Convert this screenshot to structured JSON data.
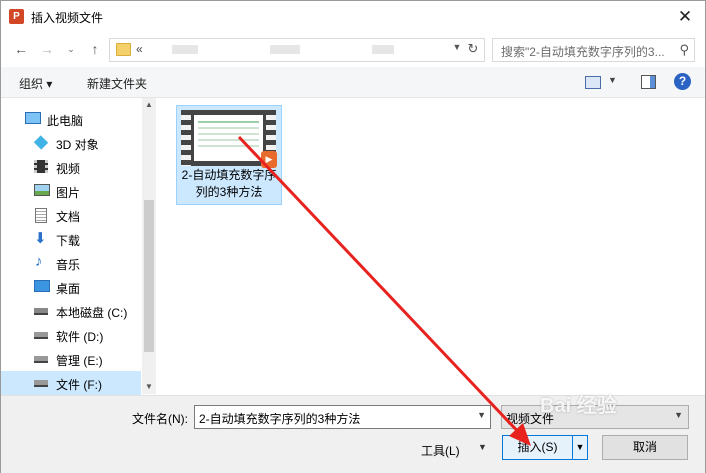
{
  "window": {
    "title": "插入视频文件",
    "app_icon_letter": "P"
  },
  "address": {
    "crumb": "«",
    "search_placeholder": "搜索\"2-自动填充数字序列的3..."
  },
  "toolbar": {
    "organize": "组织 ▾",
    "new_folder": "新建文件夹"
  },
  "nav": {
    "items": [
      {
        "label": "此电脑",
        "icon": "computer-icon"
      },
      {
        "label": "3D 对象",
        "icon": "3d-objects-icon"
      },
      {
        "label": "视频",
        "icon": "videos-icon"
      },
      {
        "label": "图片",
        "icon": "pictures-icon"
      },
      {
        "label": "文档",
        "icon": "documents-icon"
      },
      {
        "label": "下载",
        "icon": "downloads-icon"
      },
      {
        "label": "音乐",
        "icon": "music-icon"
      },
      {
        "label": "桌面",
        "icon": "desktop-icon"
      },
      {
        "label": "本地磁盘 (C:)",
        "icon": "drive-icon"
      },
      {
        "label": "软件 (D:)",
        "icon": "drive-icon"
      },
      {
        "label": "管理 (E:)",
        "icon": "drive-icon"
      },
      {
        "label": "文件 (F:)",
        "icon": "drive-icon",
        "selected": true
      }
    ]
  },
  "file": {
    "name": "2-自动填充数字序列的3种方法"
  },
  "bottom": {
    "filename_label": "文件名(N):",
    "filename_value": "2-自动填充数字序列的3种方法",
    "filter_value": "视频文件",
    "tools_label": "工具(L)",
    "insert_label": "插入(S)",
    "cancel_label": "取消"
  },
  "watermark": {
    "text": "Bai 经验"
  },
  "colors": {
    "selection": "#cce8ff",
    "accent": "#0078d7",
    "arrow": "#e8231f"
  }
}
